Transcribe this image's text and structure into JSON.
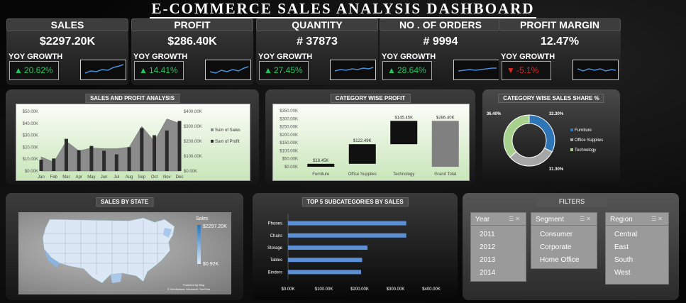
{
  "title": "E-COMMERCE SALES ANALYSIS DASHBOARD",
  "kpis": [
    {
      "label": "SALES",
      "value": "$2297.20K",
      "yoy_label": "YOY GROWTH",
      "growth": "20.62%",
      "dir": "up"
    },
    {
      "label": "PROFIT",
      "value": "$286.40K",
      "yoy_label": "YOY GROWTH",
      "growth": "14.41%",
      "dir": "up"
    },
    {
      "label": "QUANTITY",
      "value": "# 37873",
      "yoy_label": "YOY GROWTH",
      "growth": "27.45%",
      "dir": "up"
    },
    {
      "label": "NO . OF ORDERS",
      "value": "# 9994",
      "yoy_label": "YOY GROWTH",
      "growth": "28.64%",
      "dir": "up"
    },
    {
      "label": "PROFIT MARGIN",
      "value": "12.47%",
      "yoy_label": "YOY GROWTH",
      "growth": "-5.1%",
      "dir": "down"
    }
  ],
  "colors": {
    "up": "#22c55e",
    "down": "#dc2626",
    "sparkline": "#4a90d9",
    "bar": "#5b8fd6"
  },
  "panels": {
    "sales_profit": "SALES AND PROFIT ANALYSIS",
    "category_profit": "CATEGORY WISE PROFIT",
    "category_share": "CATEGORY WISE SALES SHARE %",
    "state": "SALES BY STATE",
    "top5": "TOP 5 SUBCATEGORIES BY SALES",
    "filters": "FILTERS"
  },
  "map": {
    "legend_title": "Sales",
    "max": "$2297.20K",
    "min": "$0.92K",
    "credit1": "Powered by Bing",
    "credit2": "© GeoNames, Microsoft, TomTom"
  },
  "filters": {
    "year": {
      "label": "Year",
      "items": [
        "2011",
        "2012",
        "2013",
        "2014"
      ]
    },
    "segment": {
      "label": "Segment",
      "items": [
        "Consumer",
        "Corporate",
        "Home Office"
      ]
    },
    "region": {
      "label": "Region",
      "items": [
        "Central",
        "East",
        "South",
        "West"
      ]
    }
  },
  "chart_data": [
    {
      "type": "area",
      "title": "SALES AND PROFIT ANALYSIS",
      "categories": [
        "Jan",
        "Feb",
        "Mar",
        "Apr",
        "May",
        "Jun",
        "Jul",
        "Aug",
        "Sep",
        "Oct",
        "Nov",
        "Dec"
      ],
      "y_left_ticks": [
        "$0.00K",
        "$10.00K",
        "$20.00K",
        "$30.00K",
        "$40.00K",
        "$50.00K"
      ],
      "y_right_ticks": [
        "$0.00K",
        "$100.00K",
        "$200.00K",
        "$300.00K",
        "$400.00K"
      ],
      "ylim_left": [
        0,
        50
      ],
      "ylim_right": [
        0,
        400
      ],
      "series": [
        {
          "name": "Sum of Sales",
          "axis": "right",
          "values": [
            95,
            60,
            200,
            135,
            155,
            150,
            150,
            160,
            300,
            200,
            350,
            320
          ]
        },
        {
          "name": "Sum of Profit",
          "axis": "left",
          "values": [
            9.5,
            10.5,
            27,
            17.5,
            21,
            17,
            14,
            20,
            36,
            30,
            34,
            42
          ]
        }
      ],
      "legend": "right"
    },
    {
      "type": "bar",
      "title": "CATEGORY WISE PROFIT",
      "categories": [
        "Furniture",
        "Office Supplies",
        "Technology",
        "Grand Total"
      ],
      "values": [
        18.45,
        122.49,
        145.45,
        286.4
      ],
      "labels": [
        "$18.45K",
        "$122.49K",
        "$145.45K",
        "$286.40K"
      ],
      "y_ticks": [
        "$0.00K",
        "$50.00K",
        "$100.00K",
        "$150.00K",
        "$200.00K",
        "$250.00K",
        "$300.00K",
        "$350.00K"
      ],
      "ylim": [
        0,
        350
      ]
    },
    {
      "type": "pie",
      "title": "CATEGORY WISE SALES SHARE %",
      "labels": [
        "Furniture",
        "Office Supplies",
        "Technology"
      ],
      "values": [
        32.3,
        31.3,
        36.4
      ],
      "value_labels": [
        "32.30%",
        "31.30%",
        "36.40%"
      ],
      "colors": [
        "#2e75b6",
        "#a6a6a6",
        "#a9d18e"
      ],
      "legend": "right"
    },
    {
      "type": "bar",
      "title": "TOP 5 SUBCATEGORIES BY SALES",
      "categories": [
        "Phones",
        "Chairs",
        "Storage",
        "Tables",
        "Binders"
      ],
      "values": [
        330,
        330,
        222,
        207,
        204
      ],
      "x_ticks": [
        "$0.00K",
        "$100.00K",
        "$200.00K",
        "$300.00K",
        "$400.00K"
      ],
      "xlim": [
        0,
        400
      ],
      "orientation": "horizontal"
    }
  ]
}
